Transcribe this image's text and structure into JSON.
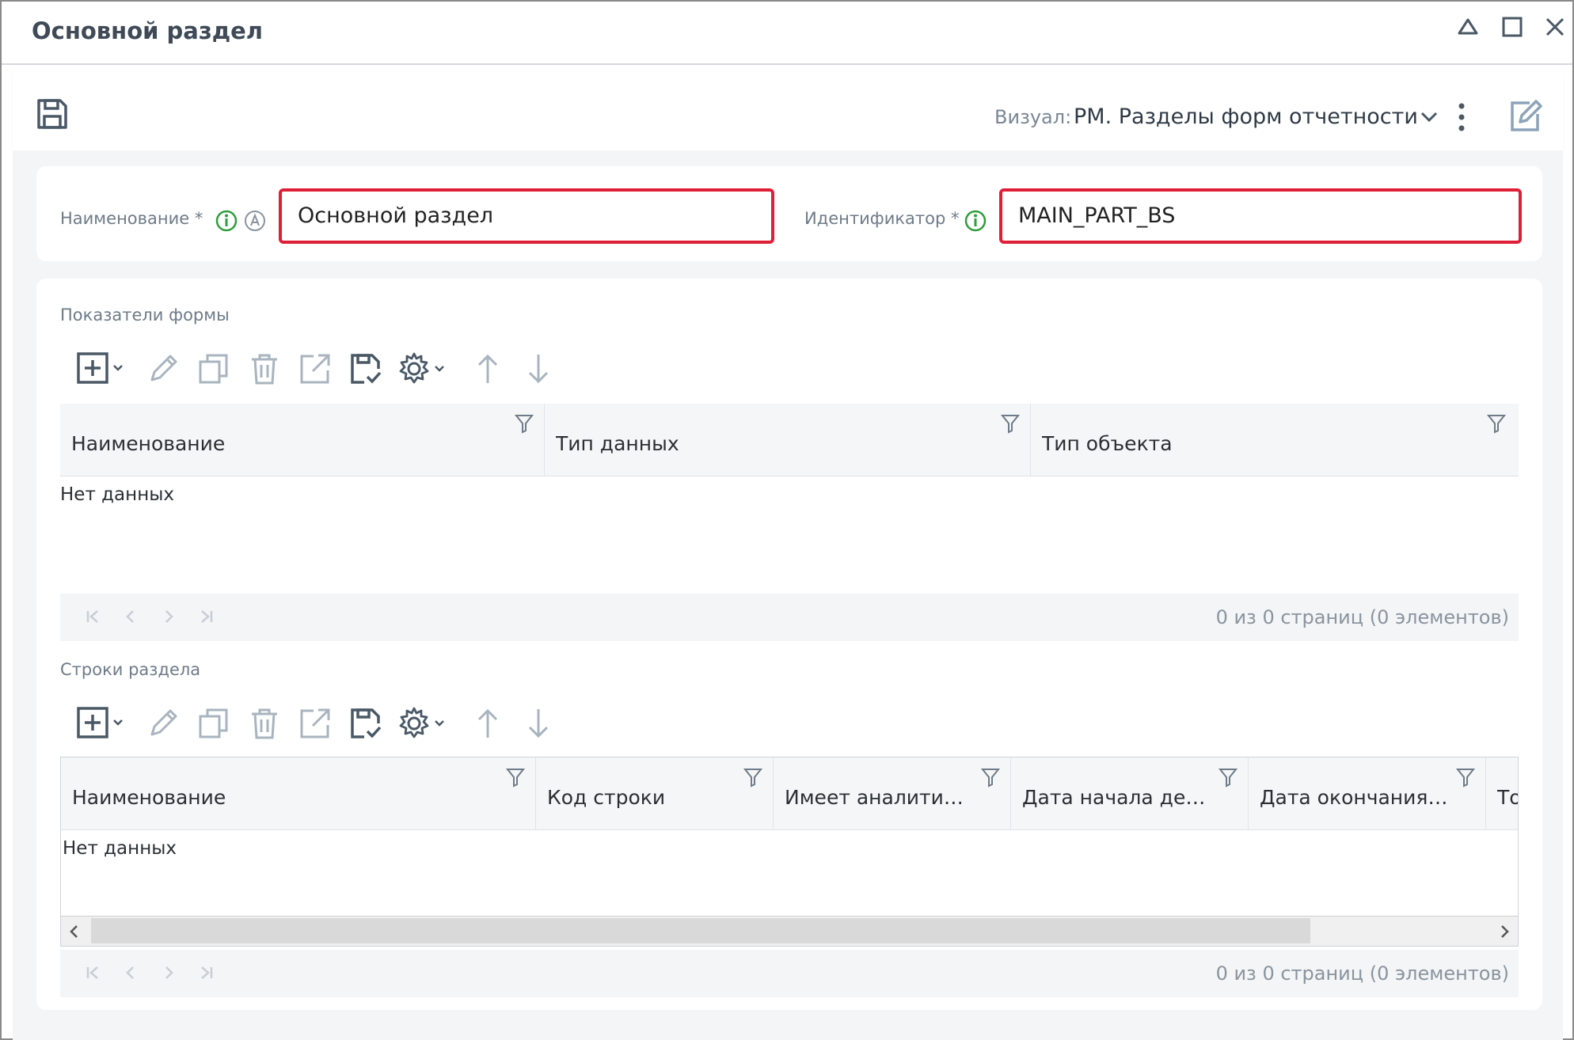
{
  "window": {
    "title": "Основной раздел",
    "controls": [
      "collapse-icon",
      "maximize-icon",
      "close-icon"
    ]
  },
  "toolbar": {
    "visual_label": "Визуал:",
    "visual_value": "РМ. Разделы форм отчетности"
  },
  "form": {
    "name_label": "Наименование *",
    "name_value": "Основной раздел",
    "id_label": "Идентификатор *",
    "id_value": "MAIN_PART_BS"
  },
  "indicators": {
    "section_label": "Показатели формы",
    "columns": [
      "Наименование",
      "Тип данных",
      "Тип объекта"
    ],
    "empty_text": "Нет данных",
    "pager_info": "0 из 0 страниц (0 элементов)"
  },
  "rows": {
    "section_label": "Строки раздела",
    "columns": [
      "Наименование",
      "Код строки",
      "Имеет аналити…",
      "Дата начала де…",
      "Дата окончания…",
      "То"
    ],
    "empty_text": "Нет данных",
    "pager_info": "0 из 0 страниц (0 элементов)"
  },
  "colors": {
    "accent_error": "#e01e37",
    "info_green": "#2e9e3a",
    "icon_gray": "#a9b4bf",
    "icon_dark": "#4a5866"
  }
}
